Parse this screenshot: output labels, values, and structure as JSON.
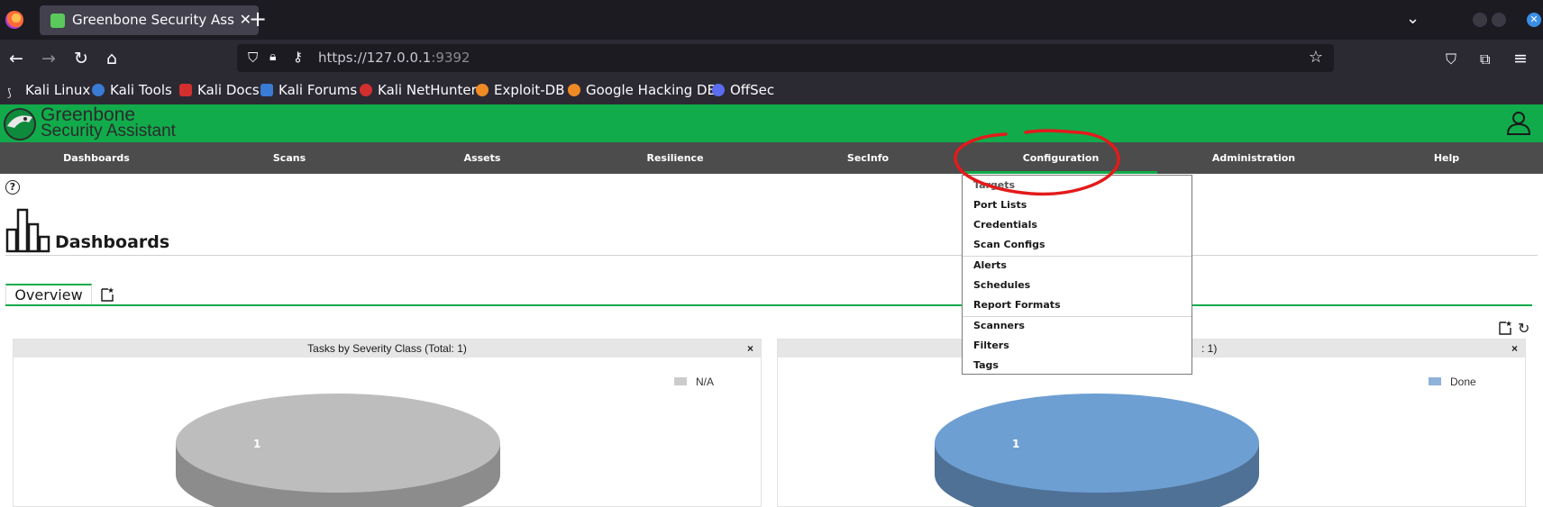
{
  "browser": {
    "tab_title": "Greenbone Security Assistant",
    "url_host": "https://127.0.0.1",
    "url_port": ":9392",
    "bookmarks": [
      {
        "label": "Kali Linux",
        "color": "#e8e8e8"
      },
      {
        "label": "Kali Tools",
        "color": "#3a7bd5"
      },
      {
        "label": "Kali Docs",
        "color": "#d32f2f"
      },
      {
        "label": "Kali Forums",
        "color": "#3a7bd5"
      },
      {
        "label": "Kali NetHunter",
        "color": "#d32f2f"
      },
      {
        "label": "Exploit-DB",
        "color": "#f08a24"
      },
      {
        "label": "Google Hacking DB",
        "color": "#f08a24"
      },
      {
        "label": "OffSec",
        "color": "#5a6cf0"
      }
    ]
  },
  "app": {
    "title_line1": "Greenbone",
    "title_line2": "Security Assistant",
    "brand_color": "#11ab4b"
  },
  "menu": {
    "items": [
      "Dashboards",
      "Scans",
      "Assets",
      "Resilience",
      "SecInfo",
      "Configuration",
      "Administration",
      "Help"
    ],
    "active": "Configuration"
  },
  "dropdown": {
    "items": [
      "Targets",
      "Port Lists",
      "Credentials",
      "Scan Configs",
      "Alerts",
      "Schedules",
      "Report Formats",
      "Scanners",
      "Filters",
      "Tags"
    ]
  },
  "page": {
    "title": "Dashboards",
    "tab_overview": "Overview"
  },
  "panels": [
    {
      "title": "Tasks by Severity Class (Total: 1)",
      "legend": "N/A",
      "legend_color": "#cccccc",
      "slice_value": "1",
      "color": "#bdbdbd"
    },
    {
      "title_visible": ": 1)",
      "legend": "Done",
      "legend_color": "#8fb2db",
      "slice_value": "1",
      "color": "#6e9fd2"
    }
  ]
}
